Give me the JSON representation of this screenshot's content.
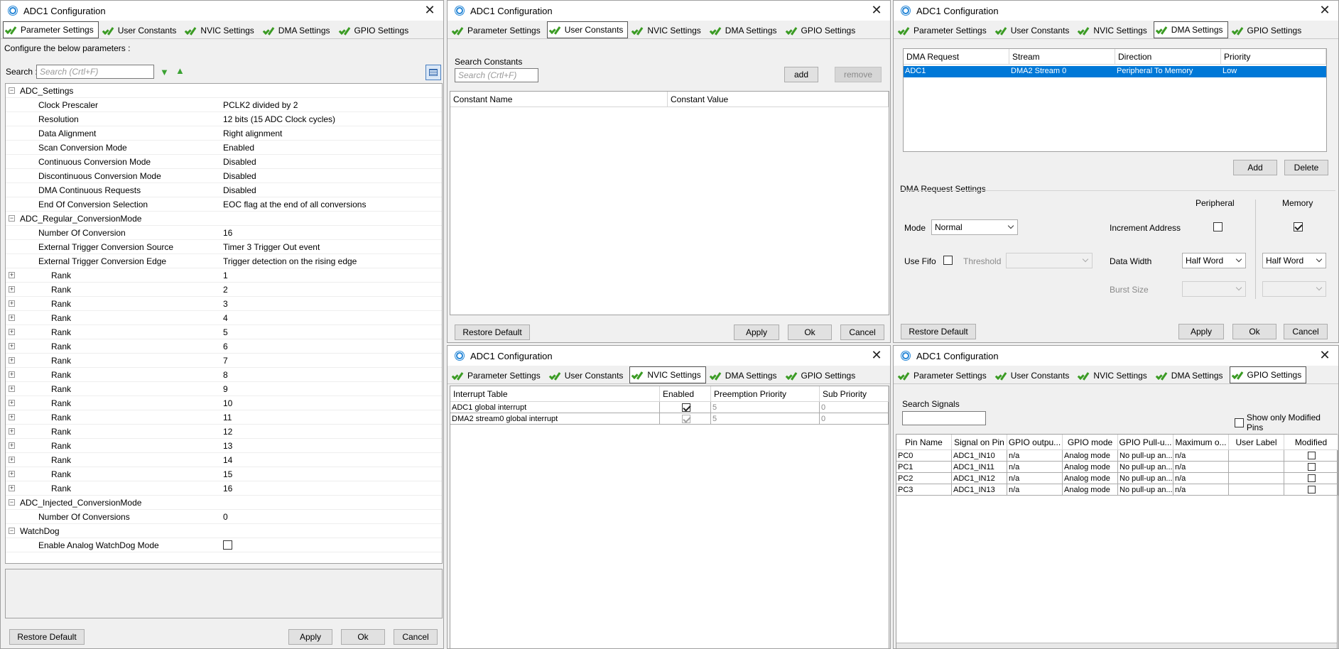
{
  "tabs": [
    "Parameter Settings",
    "User Constants",
    "NVIC Settings",
    "DMA Settings",
    "GPIO Settings"
  ],
  "window_title": "ADC1 Configuration",
  "buttons": {
    "restore_default": "Restore Default",
    "apply": "Apply",
    "ok": "Ok",
    "cancel": "Cancel"
  },
  "param": {
    "configure_text": "Configure the below parameters :",
    "search_label": "Search :",
    "search_placeholder": "Search (Crtl+F)",
    "rows": [
      {
        "type": "group",
        "label": "ADC_Settings",
        "value": ""
      },
      {
        "type": "param",
        "label": "Clock Prescaler",
        "value": "PCLK2 divided by 2"
      },
      {
        "type": "param",
        "label": "Resolution",
        "value": "12 bits (15 ADC Clock cycles)"
      },
      {
        "type": "param",
        "label": "Data Alignment",
        "value": "Right alignment"
      },
      {
        "type": "param",
        "label": "Scan Conversion Mode",
        "value": "Enabled"
      },
      {
        "type": "param",
        "label": "Continuous Conversion Mode",
        "value": "Disabled"
      },
      {
        "type": "param",
        "label": "Discontinuous Conversion Mode",
        "value": "Disabled"
      },
      {
        "type": "param",
        "label": "DMA Continuous Requests",
        "value": "Disabled"
      },
      {
        "type": "param",
        "label": "End Of Conversion Selection",
        "value": "EOC flag at the end of all conversions"
      },
      {
        "type": "group",
        "label": "ADC_Regular_ConversionMode",
        "value": ""
      },
      {
        "type": "param",
        "label": "Number Of Conversion",
        "value": "16"
      },
      {
        "type": "param",
        "label": "External Trigger Conversion Source",
        "value": "Timer 3 Trigger Out event"
      },
      {
        "type": "param",
        "label": "External Trigger Conversion Edge",
        "value": "Trigger detection on the rising edge"
      },
      {
        "type": "rank",
        "label": "Rank",
        "value": "1"
      },
      {
        "type": "rank",
        "label": "Rank",
        "value": "2"
      },
      {
        "type": "rank",
        "label": "Rank",
        "value": "3"
      },
      {
        "type": "rank",
        "label": "Rank",
        "value": "4"
      },
      {
        "type": "rank",
        "label": "Rank",
        "value": "5"
      },
      {
        "type": "rank",
        "label": "Rank",
        "value": "6"
      },
      {
        "type": "rank",
        "label": "Rank",
        "value": "7"
      },
      {
        "type": "rank",
        "label": "Rank",
        "value": "8"
      },
      {
        "type": "rank",
        "label": "Rank",
        "value": "9"
      },
      {
        "type": "rank",
        "label": "Rank",
        "value": "10"
      },
      {
        "type": "rank",
        "label": "Rank",
        "value": "11"
      },
      {
        "type": "rank",
        "label": "Rank",
        "value": "12"
      },
      {
        "type": "rank",
        "label": "Rank",
        "value": "13"
      },
      {
        "type": "rank",
        "label": "Rank",
        "value": "14"
      },
      {
        "type": "rank",
        "label": "Rank",
        "value": "15"
      },
      {
        "type": "rank",
        "label": "Rank",
        "value": "16"
      },
      {
        "type": "group",
        "label": "ADC_Injected_ConversionMode",
        "value": ""
      },
      {
        "type": "param",
        "label": "Number Of Conversions",
        "value": "0"
      },
      {
        "type": "group",
        "label": "WatchDog",
        "value": ""
      },
      {
        "type": "checkbox",
        "label": "Enable Analog WatchDog Mode",
        "value": ""
      }
    ]
  },
  "user_constants": {
    "search_label": "Search Constants",
    "search_placeholder": "Search (Crtl+F)",
    "add": "add",
    "remove": "remove",
    "col_name": "Constant Name",
    "col_value": "Constant Value"
  },
  "dma": {
    "headers": [
      "DMA Request",
      "Stream",
      "Direction",
      "Priority"
    ],
    "row": [
      "ADC1",
      "DMA2 Stream 0",
      "Peripheral To Memory",
      "Low"
    ],
    "add": "Add",
    "delete": "Delete",
    "request_settings": "DMA Request Settings",
    "peripheral": "Peripheral",
    "memory": "Memory",
    "mode_label": "Mode",
    "mode_value": "Normal",
    "increment_address": "Increment Address",
    "use_fifo": "Use Fifo",
    "threshold": "Threshold",
    "data_width": "Data Width",
    "periph_width": "Half Word",
    "mem_width": "Half Word",
    "burst_size": "Burst Size"
  },
  "nvic": {
    "headers": [
      "Interrupt Table",
      "Enabled",
      "Preemption Priority",
      "Sub Priority"
    ],
    "rows": [
      [
        "ADC1 global interrupt",
        "",
        "5",
        "0"
      ],
      [
        "DMA2 stream0 global interrupt",
        "",
        "5",
        "0"
      ]
    ]
  },
  "gpio": {
    "search_label": "Search Signals",
    "show_modified": "Show only Modified Pins",
    "headers": [
      "Pin Name",
      "Signal on Pin",
      "GPIO outpu...",
      "GPIO mode",
      "GPIO Pull-u...",
      "Maximum o...",
      "User Label",
      "Modified"
    ],
    "rows": [
      [
        "PC0",
        "ADC1_IN10",
        "n/a",
        "Analog mode",
        "No pull-up an...",
        "n/a",
        ""
      ],
      [
        "PC1",
        "ADC1_IN11",
        "n/a",
        "Analog mode",
        "No pull-up an...",
        "n/a",
        ""
      ],
      [
        "PC2",
        "ADC1_IN12",
        "n/a",
        "Analog mode",
        "No pull-up an...",
        "n/a",
        ""
      ],
      [
        "PC3",
        "ADC1_IN13",
        "n/a",
        "Analog mode",
        "No pull-up an...",
        "n/a",
        ""
      ]
    ]
  }
}
